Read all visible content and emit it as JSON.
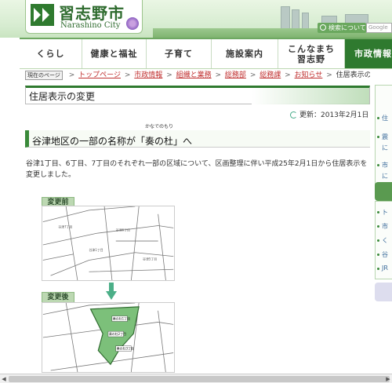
{
  "header": {
    "title": "習志野市",
    "subtitle": "Narashino City",
    "search_label": "検索について",
    "search_placeholder": "Google"
  },
  "nav": {
    "items": [
      {
        "label": "くらし"
      },
      {
        "label": "健康と福祉"
      },
      {
        "label": "子育て"
      },
      {
        "label": "施設案内"
      },
      {
        "label": "こんなまち\n習志野"
      },
      {
        "label": "市政情報"
      }
    ]
  },
  "breadcrumb": {
    "here_label": "現在のページ",
    "links": [
      "トップページ",
      "市政情報",
      "組織と業務",
      "総務部",
      "総務課",
      "お知らせ"
    ],
    "current": "住居表示の変更"
  },
  "page_title": "住居表示の変更",
  "updated": "更新：2013年2月1日",
  "heading": {
    "text": "谷津地区の一部の名称が「奏の杜」へ",
    "ruby": "かなでのもり"
  },
  "body_text": "谷津1丁目、6丁目、7丁目のそれぞれ一部の区域について、区画整理に伴い平成25年2月1日から住居表示を変更しました。",
  "maps": {
    "before_label": "変更前",
    "after_label": "変更後",
    "after_marks": [
      "奏の杜1丁目",
      "奏の杜2丁目",
      "奏の杜3丁目"
    ]
  },
  "sidebar": {
    "links": [
      "住",
      "震",
      "に",
      "市",
      "に",
      "ト",
      "市",
      "く",
      "谷",
      "JR"
    ]
  },
  "colors": {
    "brand_green": "#2f7a2f",
    "link_red": "#c03030",
    "map_green": "#7cc07a"
  }
}
